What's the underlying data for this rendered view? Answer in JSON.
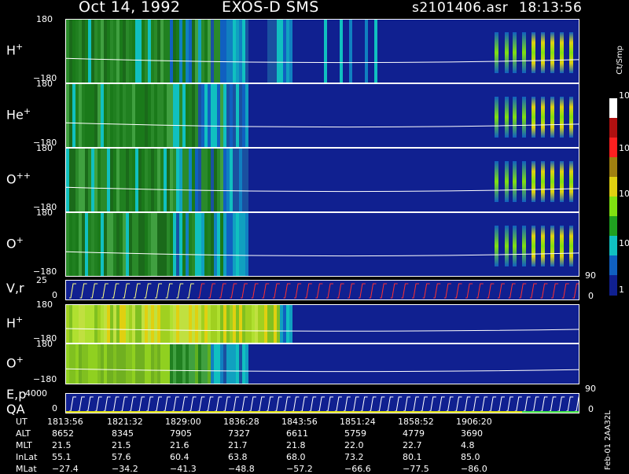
{
  "header": {
    "date": "Oct 14, 1992",
    "instrument": "EXOS-D SMS",
    "file": "s2101406.asr",
    "time": "18:13:56"
  },
  "panels": [
    {
      "id": "h1",
      "label": "H",
      "sup": "+",
      "top_tick": "180",
      "bot_tick": "−180"
    },
    {
      "id": "he",
      "label": "He",
      "sup": "+",
      "top_tick": "180",
      "bot_tick": "−180"
    },
    {
      "id": "opp",
      "label": "O",
      "sup": "++",
      "top_tick": "180",
      "bot_tick": "−180"
    },
    {
      "id": "o1",
      "label": "O",
      "sup": "+",
      "top_tick": "180",
      "bot_tick": "−180"
    },
    {
      "id": "vr",
      "label": "V,r",
      "sup": "",
      "top_tick": "25",
      "bot_tick": "0",
      "right_top": "90",
      "right_bot": "0"
    },
    {
      "id": "h2",
      "label": "H",
      "sup": "+",
      "top_tick": "180",
      "bot_tick": "−180"
    },
    {
      "id": "o2",
      "label": "O",
      "sup": "+",
      "top_tick": "180",
      "bot_tick": "−180"
    },
    {
      "id": "ep",
      "label": "E,p",
      "label2": "QA",
      "sup": "",
      "top_tick": "4000",
      "bot_tick": "0",
      "right_top": "90",
      "right_bot": "0"
    }
  ],
  "colorbar": {
    "unit": "Ct/Smp",
    "labels": [
      "10⁴",
      "10³",
      "100",
      "10",
      "1"
    ],
    "colors": [
      "#ffffff",
      "#b01010",
      "#ff2020",
      "#a08010",
      "#e0d010",
      "#80e010",
      "#20a020",
      "#10c0c0",
      "#1060c0",
      "#102090"
    ]
  },
  "chart_data": {
    "type": "heatmap",
    "title": "Oct 14, 1992   EXOS-D SMS   s2101406.asr  18:13:56",
    "x_label": "UT",
    "ut_ticks": [
      "1813:56",
      "1821:32",
      "1829:00",
      "1836:28",
      "1843:56",
      "1851:24",
      "1858:52",
      "1906:20"
    ],
    "ephemeris": {
      "ALT": [
        "8652",
        "8345",
        "7905",
        "7327",
        "6611",
        "5759",
        "4779",
        "3690"
      ],
      "MLT": [
        "21.5",
        "21.5",
        "21.6",
        "21.7",
        "21.8",
        "22.0",
        "22.7",
        "4.8"
      ],
      "InLat": [
        "55.1",
        "57.6",
        "60.4",
        "63.8",
        "68.0",
        "73.2",
        "80.1",
        "85.0"
      ],
      "MLat": [
        "−27.4",
        "−34.2",
        "−41.3",
        "−48.8",
        "−57.2",
        "−66.6",
        "−77.5",
        "−86.0"
      ]
    },
    "series": [
      {
        "name": "H+",
        "y_range": [
          -180,
          180
        ]
      },
      {
        "name": "He+",
        "y_range": [
          -180,
          180
        ]
      },
      {
        "name": "O++",
        "y_range": [
          -180,
          180
        ]
      },
      {
        "name": "O+",
        "y_range": [
          -180,
          180
        ]
      },
      {
        "name": "V,r",
        "y_range": [
          0,
          25
        ]
      },
      {
        "name": "H+",
        "y_range": [
          -180,
          180
        ]
      },
      {
        "name": "O+",
        "y_range": [
          -180,
          180
        ]
      },
      {
        "name": "E,p",
        "y_range": [
          0,
          4000
        ]
      }
    ],
    "colorbar_range": [
      1,
      10000
    ],
    "colorbar_scale": "log"
  },
  "footer": {
    "row_labels": [
      "UT",
      "ALT",
      "MLT",
      "InLat",
      "MLat"
    ],
    "side_text": "Feb-01 2AA32L"
  }
}
